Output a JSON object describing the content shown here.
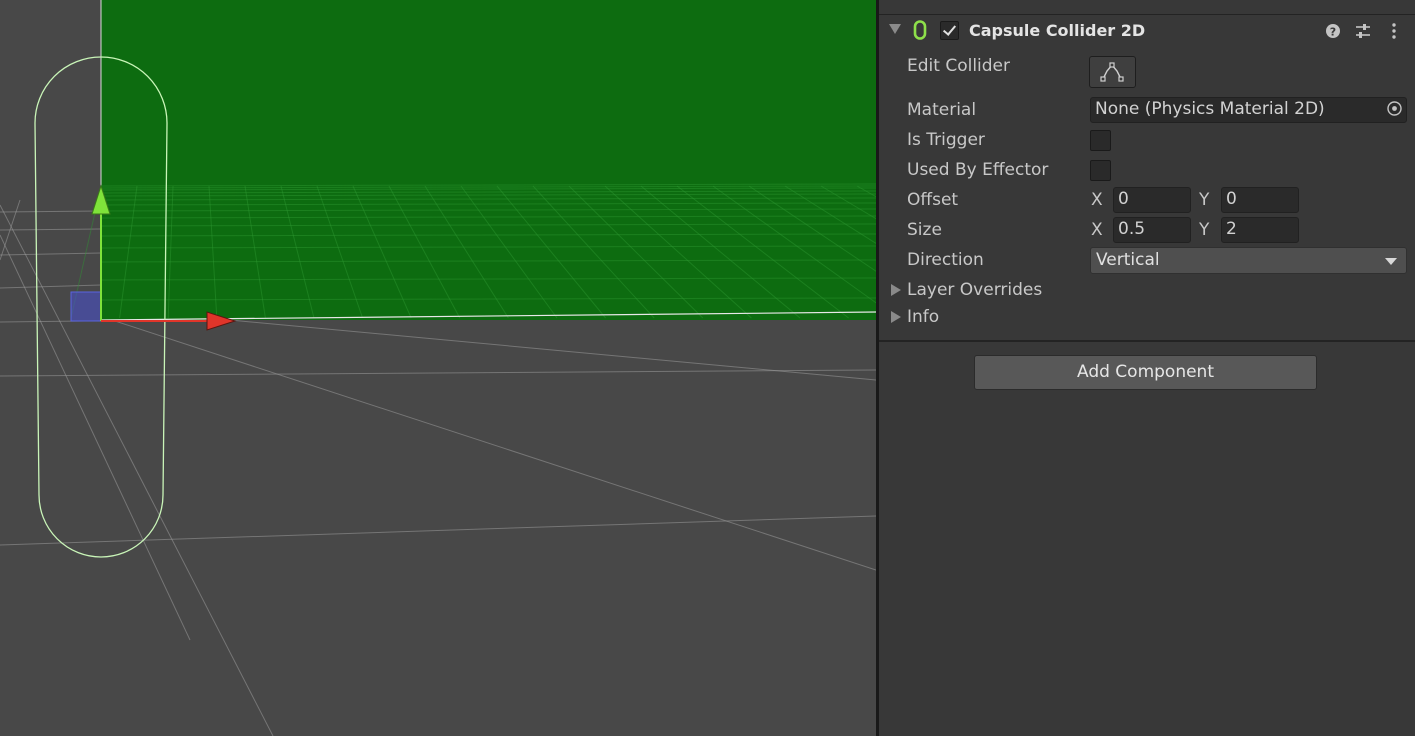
{
  "scene_view": {
    "sky_color": "#0d6c10",
    "ground_color": "#484848",
    "collider_outline_color": "#c9f5b8"
  },
  "component": {
    "title": "Capsule Collider 2D",
    "enabled": true,
    "icon": "capsule-collider-2d-icon",
    "header_icons": [
      "help-icon",
      "presets-icon",
      "kebab-menu-icon"
    ]
  },
  "fields": {
    "edit_collider": {
      "label": "Edit Collider",
      "icon": "edit-collider-icon"
    },
    "material": {
      "label": "Material",
      "value": "None (Physics Material 2D)"
    },
    "is_trigger": {
      "label": "Is Trigger",
      "checked": false
    },
    "used_by_effector": {
      "label": "Used By Effector",
      "checked": false
    },
    "offset": {
      "label": "Offset",
      "x_label": "X",
      "x": "0",
      "y_label": "Y",
      "y": "0"
    },
    "size": {
      "label": "Size",
      "x_label": "X",
      "x": "0.5",
      "y_label": "Y",
      "y": "2"
    },
    "direction": {
      "label": "Direction",
      "value": "Vertical"
    }
  },
  "foldouts": {
    "layer_overrides": "Layer Overrides",
    "info": "Info"
  },
  "add_component_label": "Add Component"
}
